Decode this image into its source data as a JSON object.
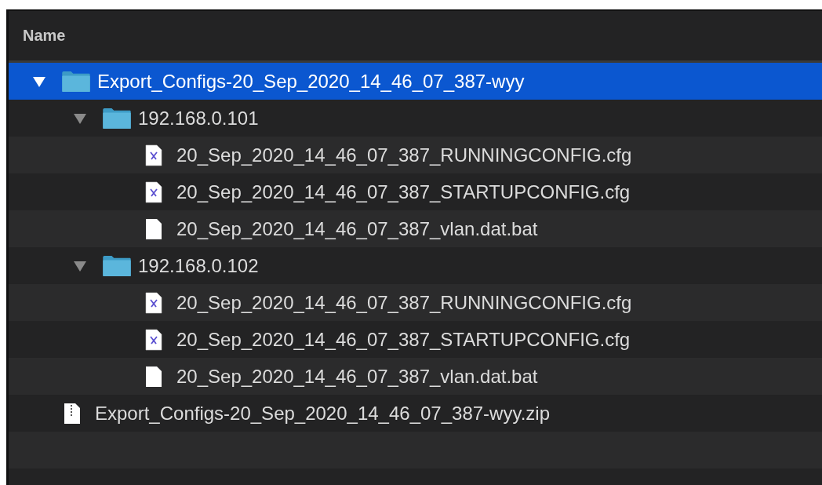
{
  "table": {
    "columns": [
      {
        "label": "Name"
      }
    ],
    "rows": [
      {
        "kind": "folder",
        "name": "Export_Configs-20_Sep_2020_14_46_07_387-wyy",
        "selected": true,
        "expanded": true,
        "children": [
          {
            "kind": "folder",
            "name": "192.168.0.101",
            "selected": false,
            "expanded": true,
            "children": [
              {
                "kind": "config",
                "name": "20_Sep_2020_14_46_07_387_RUNNINGCONFIG.cfg",
                "selected": false
              },
              {
                "kind": "config",
                "name": "20_Sep_2020_14_46_07_387_STARTUPCONFIG.cfg",
                "selected": false
              },
              {
                "kind": "document",
                "name": "20_Sep_2020_14_46_07_387_vlan.dat.bat",
                "selected": false
              }
            ]
          },
          {
            "kind": "folder",
            "name": "192.168.0.102",
            "selected": false,
            "expanded": true,
            "children": [
              {
                "kind": "config",
                "name": "20_Sep_2020_14_46_07_387_RUNNINGCONFIG.cfg",
                "selected": false
              },
              {
                "kind": "config",
                "name": "20_Sep_2020_14_46_07_387_STARTUPCONFIG.cfg",
                "selected": false
              },
              {
                "kind": "document",
                "name": "20_Sep_2020_14_46_07_387_vlan.dat.bat",
                "selected": false
              }
            ]
          }
        ]
      },
      {
        "kind": "archive",
        "name": "Export_Configs-20_Sep_2020_14_46_07_387-wyy.zip",
        "selected": false
      }
    ]
  }
}
